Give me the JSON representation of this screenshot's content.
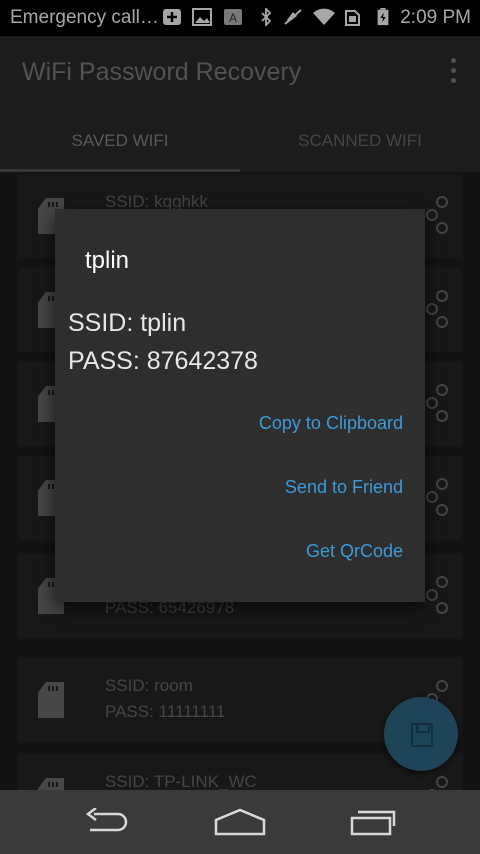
{
  "status_bar": {
    "carrier_text": "Emergency call…",
    "time": "2:09 PM",
    "icons": [
      "plus-notification-icon",
      "image-notification-icon",
      "a-notification-icon",
      "bluetooth-icon",
      "mute-icon",
      "wifi-icon",
      "sim-icon",
      "battery-charging-icon"
    ]
  },
  "app_bar": {
    "title": "WiFi Password Recovery",
    "overflow_icon": "more-vert-icon"
  },
  "tabs": [
    {
      "label": "SAVED WIFI",
      "active": true
    },
    {
      "label": "SCANNED WIFI",
      "active": false
    }
  ],
  "list": {
    "items": [
      {
        "ssid": "SSID: kqghkk",
        "pass": ""
      },
      {
        "ssid": "",
        "pass": ""
      },
      {
        "ssid": "",
        "pass": ""
      },
      {
        "ssid": "",
        "pass": ""
      },
      {
        "ssid": "",
        "pass": "PASS: 65426978"
      },
      {
        "ssid": "SSID: room",
        "pass": "PASS: 11111111"
      },
      {
        "ssid": "SSID: TP-LINK_WC",
        "pass": ""
      }
    ]
  },
  "dialog": {
    "title": "tplin",
    "ssid": "SSID: tplin",
    "pass": "PASS: 87642378",
    "buttons": {
      "copy": "Copy to Clipboard",
      "send": "Send to Friend",
      "qrcode": "Get QrCode"
    }
  },
  "fab": {
    "icon": "save-icon"
  },
  "nav_bar": {
    "icons": [
      "back-icon",
      "home-icon",
      "recents-icon"
    ]
  },
  "colors": {
    "accent": "#3d9bd6",
    "fab": "#2f6a86",
    "dialog_bg": "#2e2e2e"
  }
}
